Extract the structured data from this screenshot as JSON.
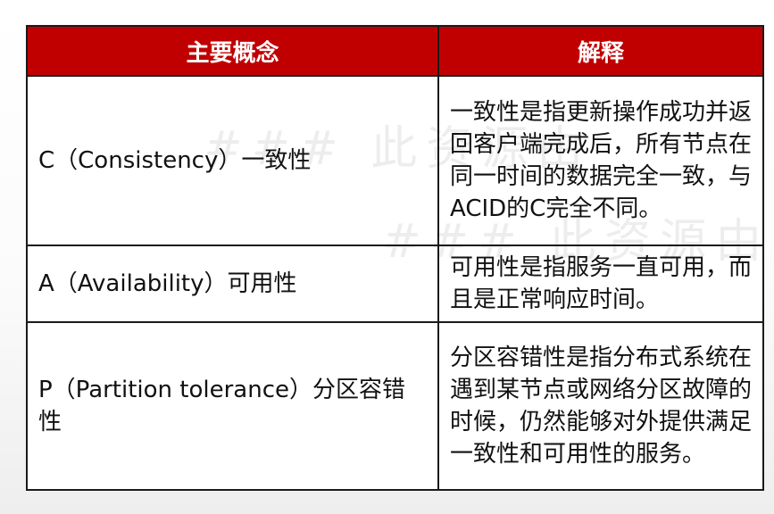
{
  "table": {
    "headers": [
      "主要概念",
      "解释"
    ],
    "rows": [
      {
        "concept": "C（Consistency）一致性",
        "explanation": "一致性是指更新操作成功并返回客户端完成后，所有节点在同一时间的数据完全一致，与ACID的C完全不同。"
      },
      {
        "concept": "A（Availability）可用性",
        "explanation": "可用性是指服务一直可用，而且是正常响应时间。"
      },
      {
        "concept": "P（Partition tolerance）分区容错性",
        "explanation": "分区容错性是指分布式系统在遇到某节点或网络分区故障的时候，仍然能够对外提供满足一致性和可用性的服务。"
      }
    ]
  },
  "watermark": {
    "line1": "### 此资源由",
    "line2": "### 此资源由 5"
  },
  "colors": {
    "header_bg": "#c00000",
    "header_text": "#ffffff",
    "border": "#1a1a1a"
  }
}
